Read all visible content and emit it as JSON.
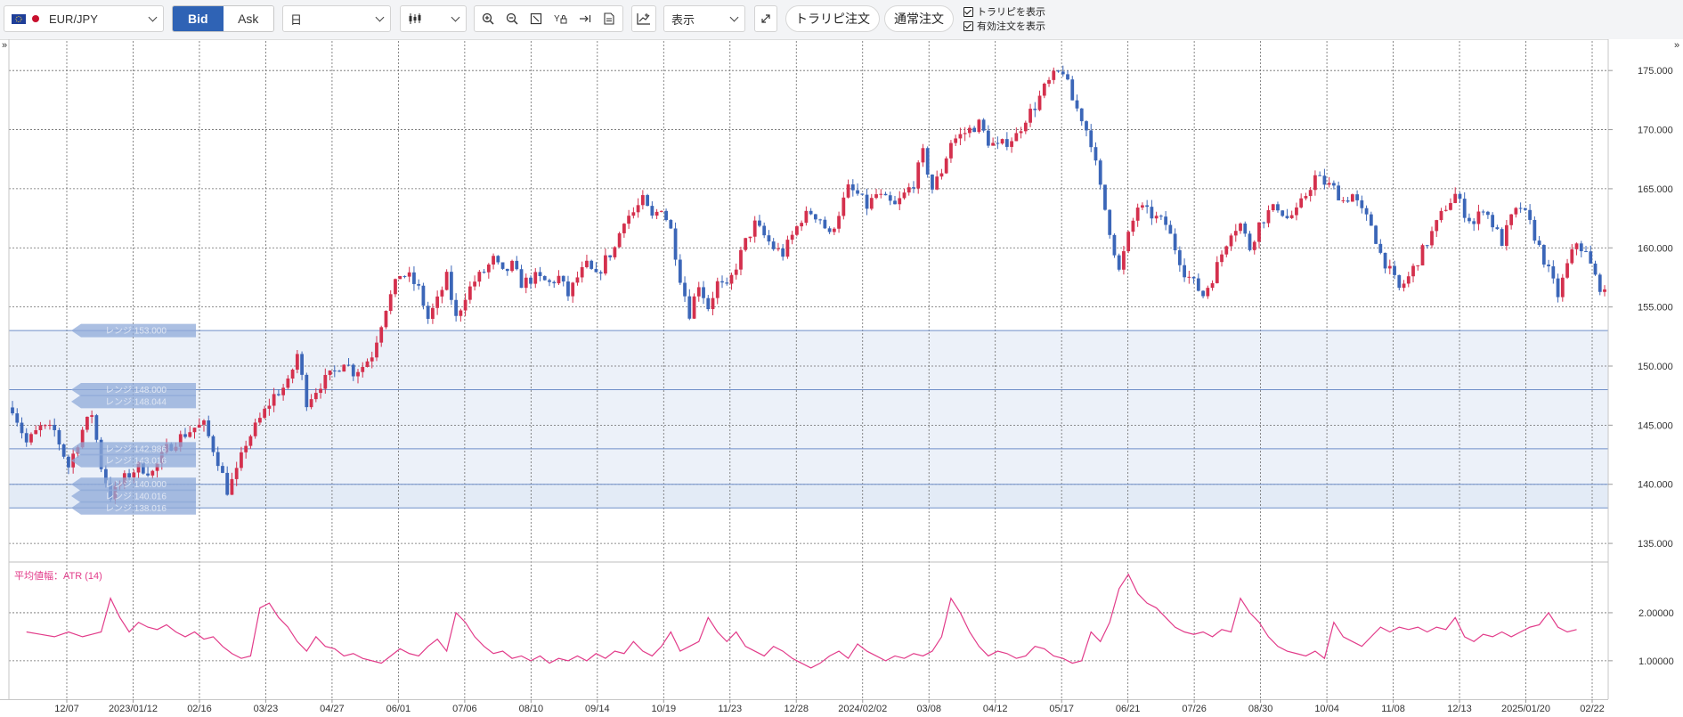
{
  "toolbar": {
    "symbol": "EUR/JPY",
    "bid_label": "Bid",
    "ask_label": "Ask",
    "timeframe": "日",
    "display_label": "表示",
    "trarip_order": "トラリピ注文",
    "normal_order": "通常注文",
    "show_trarip": "トラリピを表示",
    "show_active_orders": "有効注文を表示"
  },
  "colors": {
    "bid_active": "#2f63b5",
    "up_candle": "#d4304d",
    "down_candle": "#3b66b8",
    "range_band": "#dce5f4",
    "atr_line": "#e23c8a"
  },
  "chart_data": {
    "type": "candlestick",
    "title": "EUR/JPY",
    "ylim": [
      133.5,
      177.5
    ],
    "y_ticks": [
      {
        "v": 135,
        "label": "135.000"
      },
      {
        "v": 140,
        "label": "140.000"
      },
      {
        "v": 145,
        "label": "145.000"
      },
      {
        "v": 150,
        "label": "150.000"
      },
      {
        "v": 155,
        "label": "155.000"
      },
      {
        "v": 160,
        "label": "160.000"
      },
      {
        "v": 165,
        "label": "165.000"
      },
      {
        "v": 170,
        "label": "170.000"
      },
      {
        "v": 175,
        "label": "175.000"
      }
    ],
    "x_ticks": [
      "12/07",
      "2023/01/12",
      "02/16",
      "03/23",
      "04/27",
      "06/01",
      "07/06",
      "08/10",
      "09/14",
      "10/19",
      "11/23",
      "12/28",
      "2024/02/02",
      "03/08",
      "04/12",
      "05/17",
      "06/21",
      "07/26",
      "08/30",
      "10/04",
      "11/08",
      "12/13",
      "2025/01/20",
      "02/22"
    ],
    "close_path": [
      [
        0,
        146.5
      ],
      [
        3,
        143.5
      ],
      [
        6,
        144.8
      ],
      [
        9,
        144.5
      ],
      [
        12,
        141.5
      ],
      [
        15,
        144.6
      ],
      [
        17,
        146.0
      ],
      [
        19,
        141.5
      ],
      [
        21,
        139.0
      ],
      [
        24,
        140.5
      ],
      [
        27,
        141.5
      ],
      [
        30,
        141.0
      ],
      [
        33,
        143.0
      ],
      [
        36,
        144.0
      ],
      [
        39,
        144.8
      ],
      [
        41,
        145.0
      ],
      [
        44,
        142.0
      ],
      [
        46,
        139.5
      ],
      [
        48,
        141.0
      ],
      [
        50,
        143.5
      ],
      [
        53,
        145.5
      ],
      [
        56,
        147.5
      ],
      [
        59,
        148.5
      ],
      [
        61,
        151.0
      ],
      [
        63,
        147.0
      ],
      [
        66,
        148.5
      ],
      [
        69,
        149.5
      ],
      [
        71,
        150.5
      ],
      [
        73,
        149.5
      ],
      [
        75,
        150.0
      ],
      [
        77,
        151.0
      ],
      [
        80,
        155.0
      ],
      [
        83,
        157.8
      ],
      [
        85,
        157.5
      ],
      [
        87,
        156.5
      ],
      [
        89,
        154.0
      ],
      [
        91,
        155.5
      ],
      [
        93,
        157.5
      ],
      [
        95,
        154.0
      ],
      [
        97,
        156.0
      ],
      [
        99,
        157.2
      ],
      [
        101,
        158.0
      ],
      [
        103,
        159.0
      ],
      [
        105,
        157.8
      ],
      [
        107,
        158.5
      ],
      [
        109,
        157.0
      ],
      [
        112,
        157.5
      ],
      [
        115,
        157.0
      ],
      [
        117,
        157.5
      ],
      [
        119,
        156.0
      ],
      [
        121,
        157.5
      ],
      [
        123,
        158.5
      ],
      [
        125,
        157.5
      ],
      [
        127,
        159.0
      ],
      [
        129,
        160.0
      ],
      [
        131,
        162.5
      ],
      [
        133,
        163.0
      ],
      [
        135,
        164.0
      ],
      [
        137,
        162.5
      ],
      [
        139,
        163.5
      ],
      [
        141,
        161.5
      ],
      [
        143,
        157.5
      ],
      [
        145,
        154.5
      ],
      [
        147,
        157.0
      ],
      [
        149,
        155.0
      ],
      [
        151,
        157.0
      ],
      [
        153,
        156.5
      ],
      [
        155,
        158.5
      ],
      [
        157,
        160.5
      ],
      [
        159,
        162.0
      ],
      [
        161,
        161.0
      ],
      [
        163,
        160.0
      ],
      [
        165,
        159.5
      ],
      [
        167,
        161.0
      ],
      [
        169,
        162.5
      ],
      [
        171,
        163.0
      ],
      [
        173,
        162.5
      ],
      [
        175,
        161.0
      ],
      [
        177,
        163.0
      ],
      [
        179,
        165.0
      ],
      [
        181,
        164.5
      ],
      [
        183,
        163.5
      ],
      [
        185,
        164.5
      ],
      [
        187,
        164.0
      ],
      [
        189,
        163.5
      ],
      [
        191,
        164.5
      ],
      [
        193,
        165.5
      ],
      [
        195,
        168.0
      ],
      [
        197,
        165.0
      ],
      [
        199,
        166.5
      ],
      [
        201,
        169.0
      ],
      [
        203,
        169.5
      ],
      [
        205,
        170.0
      ],
      [
        207,
        170.5
      ],
      [
        209,
        169.0
      ],
      [
        211,
        168.5
      ],
      [
        213,
        169.0
      ],
      [
        215,
        169.5
      ],
      [
        217,
        171.0
      ],
      [
        219,
        172.0
      ],
      [
        221,
        173.5
      ],
      [
        223,
        174.5
      ],
      [
        225,
        175.0
      ],
      [
        227,
        172.5
      ],
      [
        229,
        171.0
      ],
      [
        231,
        169.0
      ],
      [
        233,
        165.0
      ],
      [
        235,
        161.5
      ],
      [
        237,
        158.0
      ],
      [
        239,
        161.0
      ],
      [
        241,
        163.5
      ],
      [
        243,
        163.0
      ],
      [
        245,
        162.5
      ],
      [
        247,
        162.0
      ],
      [
        249,
        160.0
      ],
      [
        251,
        158.0
      ],
      [
        253,
        157.0
      ],
      [
        255,
        156.0
      ],
      [
        257,
        157.5
      ],
      [
        259,
        159.5
      ],
      [
        261,
        161.5
      ],
      [
        263,
        162.0
      ],
      [
        265,
        160.0
      ],
      [
        267,
        162.0
      ],
      [
        269,
        163.0
      ],
      [
        271,
        163.5
      ],
      [
        273,
        162.5
      ],
      [
        275,
        163.0
      ],
      [
        277,
        164.5
      ],
      [
        279,
        166.0
      ],
      [
        281,
        165.5
      ],
      [
        283,
        165.0
      ],
      [
        285,
        164.0
      ],
      [
        287,
        164.5
      ],
      [
        289,
        163.0
      ],
      [
        291,
        162.0
      ],
      [
        293,
        159.5
      ],
      [
        295,
        158.0
      ],
      [
        297,
        156.5
      ],
      [
        299,
        157.5
      ],
      [
        301,
        159.0
      ],
      [
        303,
        160.5
      ],
      [
        305,
        162.0
      ],
      [
        307,
        163.5
      ],
      [
        309,
        164.5
      ],
      [
        311,
        163.0
      ],
      [
        313,
        162.0
      ],
      [
        315,
        163.5
      ],
      [
        317,
        162.0
      ],
      [
        319,
        160.5
      ],
      [
        321,
        162.5
      ],
      [
        323,
        163.5
      ],
      [
        325,
        162.0
      ],
      [
        327,
        160.0
      ],
      [
        329,
        158.0
      ],
      [
        331,
        156.0
      ],
      [
        333,
        158.5
      ],
      [
        335,
        160.5
      ],
      [
        337,
        159.5
      ],
      [
        339,
        157.5
      ],
      [
        341,
        156.0
      ]
    ],
    "atr": {
      "label": "平均値幅：ATR (14)",
      "ylim": [
        0.2,
        3.0
      ],
      "y_ticks": [
        {
          "v": 1.0,
          "label": "1.00000"
        },
        {
          "v": 2.0,
          "label": "2.00000"
        }
      ],
      "path": [
        [
          0,
          1.6
        ],
        [
          3,
          1.55
        ],
        [
          6,
          1.5
        ],
        [
          9,
          1.6
        ],
        [
          12,
          1.5
        ],
        [
          14,
          1.55
        ],
        [
          16,
          1.6
        ],
        [
          18,
          2.3
        ],
        [
          20,
          1.9
        ],
        [
          22,
          1.6
        ],
        [
          24,
          1.8
        ],
        [
          26,
          1.7
        ],
        [
          28,
          1.65
        ],
        [
          30,
          1.75
        ],
        [
          32,
          1.6
        ],
        [
          34,
          1.5
        ],
        [
          36,
          1.6
        ],
        [
          38,
          1.45
        ],
        [
          40,
          1.5
        ],
        [
          42,
          1.3
        ],
        [
          44,
          1.15
        ],
        [
          46,
          1.05
        ],
        [
          48,
          1.1
        ],
        [
          50,
          2.1
        ],
        [
          52,
          2.2
        ],
        [
          54,
          1.9
        ],
        [
          56,
          1.7
        ],
        [
          58,
          1.4
        ],
        [
          60,
          1.2
        ],
        [
          62,
          1.5
        ],
        [
          64,
          1.3
        ],
        [
          66,
          1.25
        ],
        [
          68,
          1.1
        ],
        [
          70,
          1.15
        ],
        [
          72,
          1.05
        ],
        [
          74,
          1.0
        ],
        [
          76,
          0.95
        ],
        [
          78,
          1.1
        ],
        [
          80,
          1.25
        ],
        [
          82,
          1.15
        ],
        [
          84,
          1.1
        ],
        [
          86,
          1.3
        ],
        [
          88,
          1.45
        ],
        [
          90,
          1.2
        ],
        [
          92,
          2.0
        ],
        [
          94,
          1.8
        ],
        [
          96,
          1.5
        ],
        [
          98,
          1.3
        ],
        [
          100,
          1.15
        ],
        [
          102,
          1.2
        ],
        [
          104,
          1.05
        ],
        [
          106,
          1.1
        ],
        [
          108,
          1.0
        ],
        [
          110,
          1.1
        ],
        [
          112,
          0.95
        ],
        [
          114,
          1.05
        ],
        [
          116,
          1.0
        ],
        [
          118,
          1.1
        ],
        [
          120,
          1.0
        ],
        [
          122,
          1.15
        ],
        [
          124,
          1.05
        ],
        [
          126,
          1.2
        ],
        [
          128,
          1.15
        ],
        [
          130,
          1.4
        ],
        [
          132,
          1.2
        ],
        [
          134,
          1.1
        ],
        [
          136,
          1.3
        ],
        [
          138,
          1.6
        ],
        [
          140,
          1.2
        ],
        [
          142,
          1.3
        ],
        [
          144,
          1.4
        ],
        [
          146,
          1.9
        ],
        [
          148,
          1.6
        ],
        [
          150,
          1.4
        ],
        [
          152,
          1.6
        ],
        [
          154,
          1.3
        ],
        [
          156,
          1.2
        ],
        [
          158,
          1.1
        ],
        [
          160,
          1.3
        ],
        [
          162,
          1.2
        ],
        [
          164,
          1.05
        ],
        [
          166,
          0.95
        ],
        [
          168,
          0.85
        ],
        [
          170,
          0.95
        ],
        [
          172,
          1.1
        ],
        [
          174,
          1.2
        ],
        [
          176,
          1.05
        ],
        [
          178,
          1.35
        ],
        [
          180,
          1.2
        ],
        [
          182,
          1.1
        ],
        [
          184,
          1.0
        ],
        [
          186,
          1.1
        ],
        [
          188,
          1.05
        ],
        [
          190,
          1.15
        ],
        [
          192,
          1.1
        ],
        [
          194,
          1.2
        ],
        [
          196,
          1.5
        ],
        [
          198,
          2.3
        ],
        [
          200,
          2.0
        ],
        [
          202,
          1.6
        ],
        [
          204,
          1.3
        ],
        [
          206,
          1.1
        ],
        [
          208,
          1.2
        ],
        [
          210,
          1.15
        ],
        [
          212,
          1.05
        ],
        [
          214,
          1.1
        ],
        [
          216,
          1.3
        ],
        [
          218,
          1.25
        ],
        [
          220,
          1.1
        ],
        [
          222,
          1.05
        ],
        [
          224,
          0.95
        ],
        [
          226,
          1.0
        ],
        [
          228,
          1.6
        ],
        [
          230,
          1.4
        ],
        [
          232,
          1.8
        ],
        [
          234,
          2.5
        ],
        [
          236,
          2.8
        ],
        [
          238,
          2.4
        ],
        [
          240,
          2.2
        ],
        [
          242,
          2.1
        ],
        [
          244,
          1.9
        ],
        [
          246,
          1.7
        ],
        [
          248,
          1.6
        ],
        [
          250,
          1.55
        ],
        [
          252,
          1.6
        ],
        [
          254,
          1.5
        ],
        [
          256,
          1.65
        ],
        [
          258,
          1.6
        ],
        [
          260,
          2.3
        ],
        [
          262,
          2.0
        ],
        [
          264,
          1.8
        ],
        [
          266,
          1.5
        ],
        [
          268,
          1.3
        ],
        [
          270,
          1.2
        ],
        [
          272,
          1.15
        ],
        [
          274,
          1.1
        ],
        [
          276,
          1.2
        ],
        [
          278,
          1.05
        ],
        [
          280,
          1.8
        ],
        [
          282,
          1.5
        ],
        [
          284,
          1.4
        ],
        [
          286,
          1.3
        ],
        [
          288,
          1.5
        ],
        [
          290,
          1.7
        ],
        [
          292,
          1.6
        ],
        [
          294,
          1.7
        ],
        [
          296,
          1.65
        ],
        [
          298,
          1.7
        ],
        [
          300,
          1.6
        ],
        [
          302,
          1.7
        ],
        [
          304,
          1.65
        ],
        [
          306,
          1.9
        ],
        [
          308,
          1.5
        ],
        [
          310,
          1.4
        ],
        [
          312,
          1.55
        ],
        [
          314,
          1.5
        ],
        [
          316,
          1.6
        ],
        [
          318,
          1.5
        ],
        [
          320,
          1.6
        ],
        [
          322,
          1.7
        ],
        [
          324,
          1.75
        ],
        [
          326,
          2.0
        ],
        [
          328,
          1.7
        ],
        [
          330,
          1.6
        ],
        [
          332,
          1.65
        ]
      ]
    },
    "ranges": [
      {
        "low": 138.0,
        "high": 153.0
      },
      {
        "low": 138.0,
        "high": 140.0
      }
    ],
    "range_tags": [
      {
        "value": 153.0,
        "label": "レンジ 153.000"
      },
      {
        "value": 148.0,
        "label": "レンジ 148.000"
      },
      {
        "value": 147.0,
        "label": "レンジ 148.044"
      },
      {
        "value": 143.0,
        "label": "レンジ 142.986"
      },
      {
        "value": 142.0,
        "label": "レンジ 143.016"
      },
      {
        "value": 140.0,
        "label": "レンジ 140.000"
      },
      {
        "value": 139.0,
        "label": "レンジ 140.016"
      },
      {
        "value": 138.0,
        "label": "レンジ 138.016"
      }
    ],
    "order_lines": [
      153.0,
      148.0,
      143.0,
      140.0,
      138.0
    ]
  }
}
